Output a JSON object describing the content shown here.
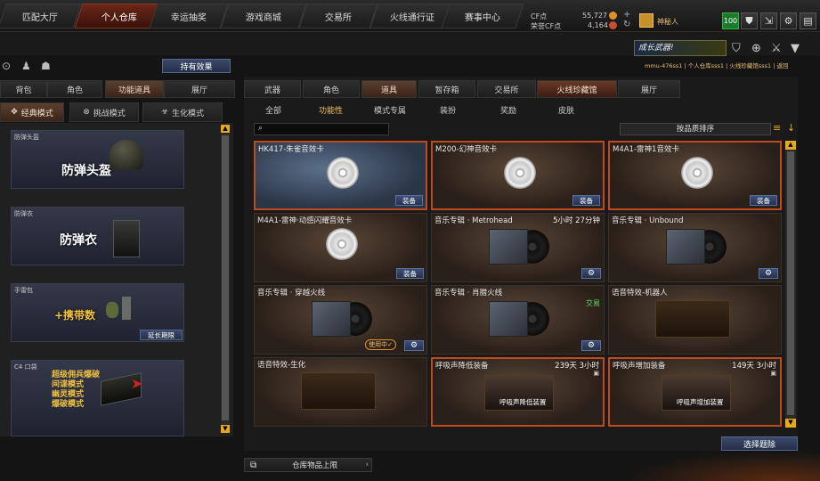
{
  "topnav": {
    "tabs": [
      "匹配大厅",
      "个人仓库",
      "幸运抽奖",
      "游戏商城",
      "交易所",
      "火线通行证",
      "赛事中心"
    ],
    "active": 1
  },
  "resources": {
    "label1": "CF点",
    "label2": "荣誉CF点",
    "val1": "55,727",
    "val2": "4,164",
    "rank": "神秘人"
  },
  "level_badge": "100",
  "left": {
    "effects_btn": "持有效果",
    "tabs": [
      "背包",
      "角色",
      "功能道具",
      "展厅"
    ],
    "active_tab": 2,
    "modes": [
      "经典模式",
      "挑战模式",
      "生化模式"
    ],
    "cards": [
      {
        "tag": "防弹头盔",
        "big": "防弹头盔"
      },
      {
        "tag": "防弹衣",
        "big": "防弹衣"
      },
      {
        "tag": "手雷包",
        "big": "+携带数",
        "btn": "延长期限"
      },
      {
        "tag": "C4 口袋",
        "lines": [
          "超级佣兵爆破",
          "间谍模式",
          "幽灵模式",
          "爆破模式"
        ]
      }
    ]
  },
  "right": {
    "banner": "成长武器!",
    "breadcrumb": "mmu-476ss1 | 个人仓库sss1 | 火线珍藏馆sss1 | 返回",
    "tabs": [
      "武器",
      "角色",
      "道具",
      "暂存箱",
      "交易所",
      "火线珍藏馆",
      "展厅"
    ],
    "active_tab": 5,
    "filters": [
      "全部",
      "功能性",
      "模式专属",
      "装扮",
      "奖励",
      "皮肤"
    ],
    "active_filter": 1,
    "search_placeholder": "",
    "sort": "按品质排序",
    "items": [
      {
        "name": "HK417-朱雀音效卡",
        "btn": "装备",
        "kind": "disc"
      },
      {
        "name": "M200-幻神音效卡",
        "btn": "装备",
        "kind": "disc"
      },
      {
        "name": "M4A1-雷神1音效卡",
        "btn": "装备",
        "kind": "disc"
      },
      {
        "name": "M4A1-雷神·动感闪耀音效卡",
        "btn": "装备",
        "kind": "disc"
      },
      {
        "name": "音乐专辑 · Metrohead",
        "time": "5小时 27分钟",
        "kind": "album"
      },
      {
        "name": "音乐专辑 · Unbound",
        "kind": "album"
      },
      {
        "name": "音乐专辑 · 穿越火线",
        "status": "使用中✓",
        "kind": "album"
      },
      {
        "name": "音乐专辑 · 肖腊火线",
        "status2": "交易",
        "kind": "album"
      },
      {
        "name": "语音特效-机器人",
        "kind": "voice"
      },
      {
        "name": "语音特效-生化",
        "kind": "voice"
      },
      {
        "name": "呼吸声降低装备",
        "time": "239天 3小时",
        "inner": "呼吸声降低装置",
        "kind": "breath"
      },
      {
        "name": "呼吸声增加装备",
        "time": "149天 3小时",
        "inner": "呼吸声增加装置",
        "kind": "breath"
      }
    ],
    "select_btn": "选择题除",
    "storage_label": "仓库物品上限"
  }
}
